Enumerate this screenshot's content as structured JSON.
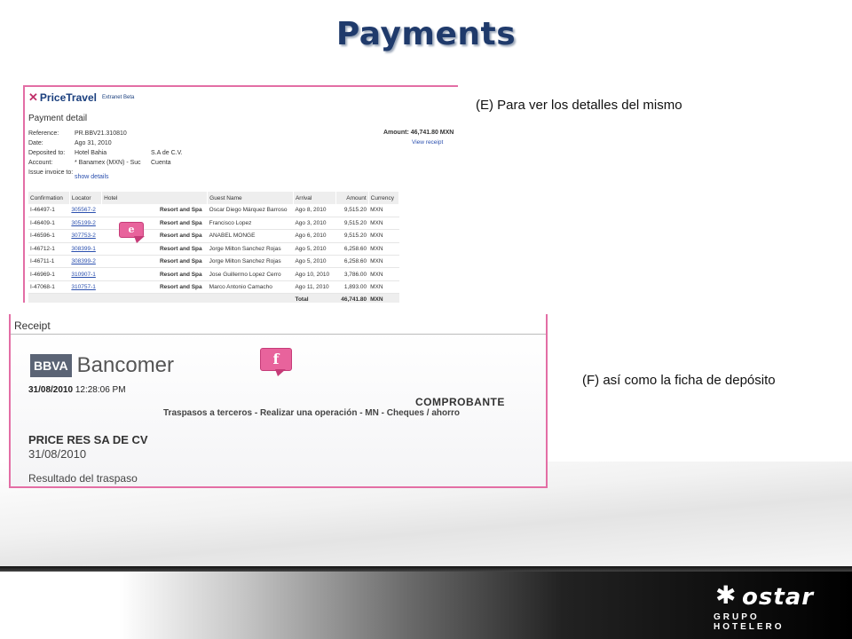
{
  "slide": {
    "title": "Payments",
    "caption_e": "(E) Para ver los detalles del mismo",
    "caption_f": "(F) así como la ficha de depósito"
  },
  "pricetravel": {
    "logo": "PriceTravel",
    "logo_sub": "Extranet Beta",
    "heading": "Payment detail",
    "fields": [
      {
        "label": "Reference:",
        "value": "PR.BBV21.310810",
        "extra": ""
      },
      {
        "label": "Date:",
        "value": "Ago 31, 2010",
        "extra": ""
      },
      {
        "label": "Deposited to:",
        "value": "Hotel Bahia",
        "extra": "S.A de C.V."
      },
      {
        "label": "Account:",
        "value": "* Banamex (MXN) - Suc",
        "extra": "Cuenta"
      },
      {
        "label": "Issue invoice to:",
        "value": "",
        "extra": ""
      }
    ],
    "amount": "Amount: 46,741.80 MXN",
    "view_receipt": "View receipt",
    "show_details": "show details",
    "columns": [
      "Confirmation",
      "Locator",
      "Hotel",
      "Guest Name",
      "Arrival",
      "Amount",
      "Currency"
    ],
    "rows": [
      [
        "I-46497-1",
        "305567-2",
        "Resort and Spa",
        "Oscar Diego Márquez Barroso",
        "Ago 8, 2010",
        "9,515.20",
        "MXN"
      ],
      [
        "I-46409-1",
        "305199-2",
        "Resort and Spa",
        "Francisco Lopez",
        "Ago 3, 2010",
        "9,515.20",
        "MXN"
      ],
      [
        "I-46596-1",
        "307753-2",
        "Resort and Spa",
        "ANABEL MONGE",
        "Ago 6, 2010",
        "9,515.20",
        "MXN"
      ],
      [
        "I-46712-1",
        "308399-1",
        "Resort and Spa",
        "Jorge Milton Sanchez Rojas",
        "Ago 5, 2010",
        "6,258.60",
        "MXN"
      ],
      [
        "I-46711-1",
        "308399-2",
        "Resort and Spa",
        "Jorge Milton Sanchez Rojas",
        "Ago 5, 2010",
        "6,258.60",
        "MXN"
      ],
      [
        "I-46969-1",
        "310907-1",
        "Resort and Spa",
        "Jose Guillermo Lopez Cerro",
        "Ago 10, 2010",
        "3,786.00",
        "MXN"
      ],
      [
        "I-47068-1",
        "310757-1",
        "Resort and Spa",
        "Marco Antonio Camacho",
        "Ago 11, 2010",
        "1,893.00",
        "MXN"
      ]
    ],
    "total_label": "Total",
    "total_amount": "46,741.80",
    "total_currency": "MXN"
  },
  "badges": {
    "e": "e",
    "f": "f"
  },
  "receipt": {
    "title": "Receipt",
    "bank_box": "BBVA",
    "bank_name": "Bancomer",
    "datetime_date": "31/08/2010",
    "datetime_time": "12:28:06 PM",
    "comprobante": "COMPROBANTE",
    "transaction": "Traspasos a terceros - Realizar una operación - MN - Cheques / ahorro",
    "payee": "PRICE RES SA DE CV",
    "date": "31/08/2010",
    "result": "Resultado del traspaso"
  },
  "brand": {
    "word": "ostar",
    "tagline": "GRUPO HOTELERO"
  }
}
